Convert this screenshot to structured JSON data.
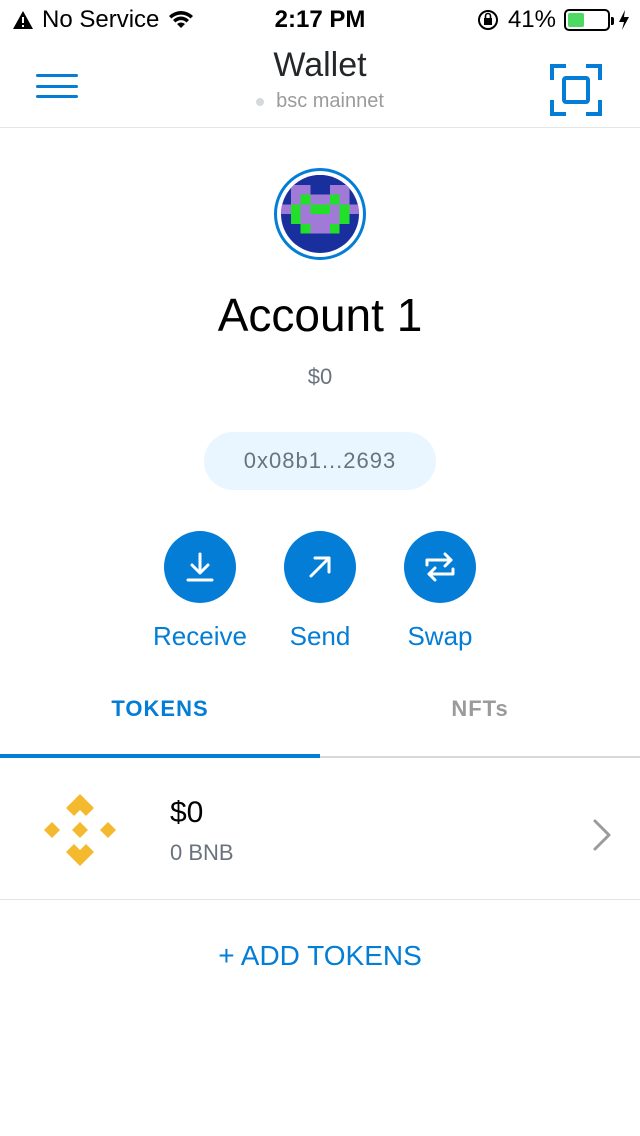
{
  "status_bar": {
    "carrier": "No Service",
    "time": "2:17 PM",
    "battery": "41%",
    "battery_level": 0.41,
    "icons": [
      "warning-icon",
      "wifi-icon",
      "orientation-lock-icon",
      "battery-icon",
      "charging-icon"
    ]
  },
  "header": {
    "title": "Wallet",
    "network": "bsc mainnet",
    "icons": [
      "hamburger-menu-icon",
      "scan-icon"
    ]
  },
  "account": {
    "name": "Account 1",
    "balance": "$0",
    "address": "0x08b1...2693"
  },
  "actions": [
    {
      "label": "Receive",
      "icon": "download-icon"
    },
    {
      "label": "Send",
      "icon": "arrow-up-right-icon"
    },
    {
      "label": "Swap",
      "icon": "swap-arrows-icon"
    }
  ],
  "tabs": [
    {
      "label": "TOKENS",
      "active": true
    },
    {
      "label": "NFTs",
      "active": false
    }
  ],
  "tokens": [
    {
      "fiat": "$0",
      "amount": "0 BNB",
      "icon": "bnb-logo-icon"
    }
  ],
  "add_tokens": "+ ADD TOKENS",
  "colors": {
    "accent": "#037dd6",
    "bnb": "#f3ba2f",
    "battery": "#4cd964"
  }
}
